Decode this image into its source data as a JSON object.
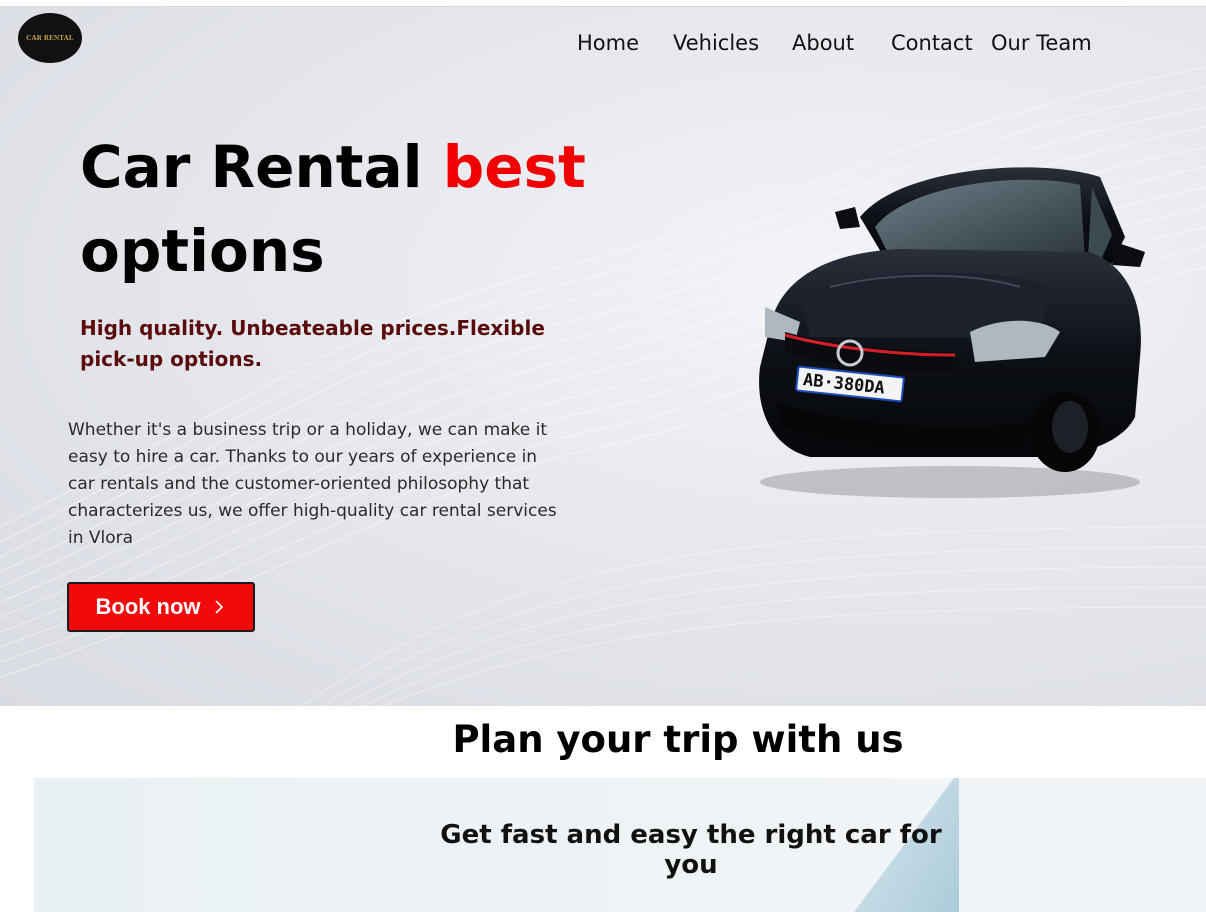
{
  "brand": {
    "logo_text": "CAR RENTAL"
  },
  "nav": {
    "items": [
      "Home",
      "Vehicles",
      "About",
      "Contact",
      "Our Team"
    ]
  },
  "hero": {
    "title_part1": "Car Rental ",
    "title_accent": "best",
    "title_part2": "options",
    "tagline": "High quality. Unbeateable prices.Flexible pick-up options.",
    "intro": "Whether it's a business trip or a holiday, we can make it easy to hire a car. Thanks to our years of experience in car rentals and the customer-oriented philosophy that characterizes us, we offer high-quality car rental services in Vlora",
    "cta_label": "Book now",
    "cta_icon": "chevron-right-icon",
    "car_plate": "AB·380DA"
  },
  "plan": {
    "title": "Plan your trip with us",
    "subtitle": "Get fast and easy the right car for you"
  },
  "colors": {
    "accent": "#f00000",
    "tagline": "#5a0b0b",
    "button": "#f00a0a"
  }
}
